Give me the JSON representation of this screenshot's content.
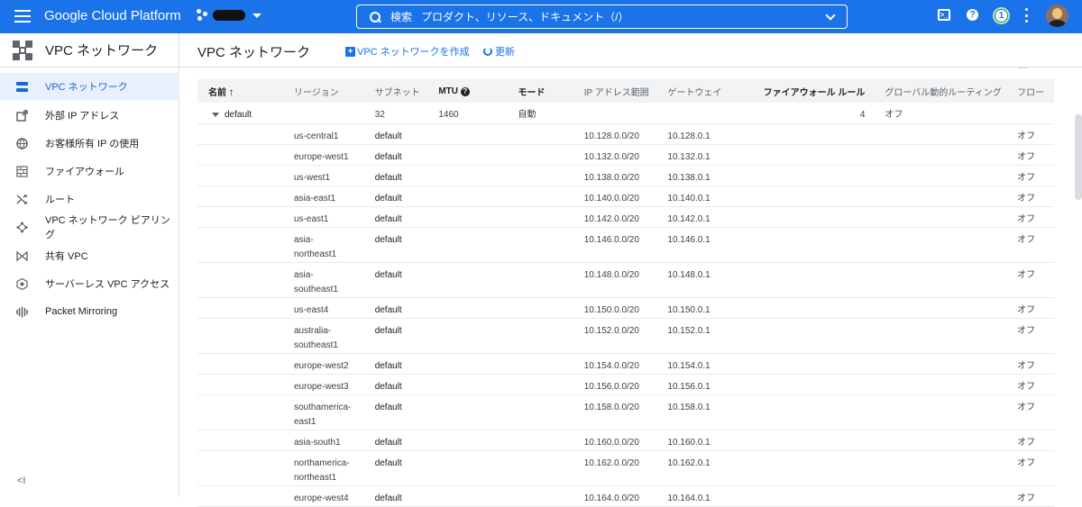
{
  "topbar": {
    "brand": "Google Cloud Platform",
    "search_label": "検索",
    "search_placeholder": "プロダクト、リソース、ドキュメント（/）",
    "notification_count": "1",
    "terminal_glyph": ">_",
    "help_glyph": "?"
  },
  "sidebar": {
    "title": "VPC ネットワーク",
    "items": [
      {
        "label": "VPC ネットワーク",
        "icon": "vpc-network-icon"
      },
      {
        "label": "外部 IP アドレス",
        "icon": "external-ip-icon"
      },
      {
        "label": "お客様所有 IP の使用",
        "icon": "globe-icon"
      },
      {
        "label": "ファイアウォール",
        "icon": "firewall-icon"
      },
      {
        "label": "ルート",
        "icon": "routes-icon"
      },
      {
        "label": "VPC ネットワーク ピアリング",
        "icon": "peering-icon"
      },
      {
        "label": "共有 VPC",
        "icon": "shared-vpc-icon"
      },
      {
        "label": "サーバーレス VPC アクセス",
        "icon": "serverless-icon"
      },
      {
        "label": "Packet Mirroring",
        "icon": "packet-mirroring-icon"
      }
    ],
    "collapse_label": "<I"
  },
  "main": {
    "title": "VPC ネットワーク",
    "create_label": "VPC ネットワークを作成",
    "refresh_label": "更新"
  },
  "table": {
    "headers": {
      "name": "名前",
      "region": "リージョン",
      "subnet": "サブネット",
      "mtu": "MTU",
      "mode": "モード",
      "ip_range": "IP アドレス範囲",
      "gateway": "ゲートウェイ",
      "firewall": "ファイアウォール ルール",
      "routing": "グローバル動的ルーティング",
      "flow": "フロー"
    },
    "network": {
      "name": "default",
      "subnets": "32",
      "mtu": "1460",
      "mode": "自動",
      "firewall_rules": "4",
      "routing": "オフ"
    },
    "rows": [
      {
        "region": "us-central1",
        "subnet": "default",
        "ip": "10.128.0.0/20",
        "gateway": "10.128.0.1",
        "flow": "オフ"
      },
      {
        "region": "europe-west1",
        "subnet": "default",
        "ip": "10.132.0.0/20",
        "gateway": "10.132.0.1",
        "flow": "オフ"
      },
      {
        "region": "us-west1",
        "subnet": "default",
        "ip": "10.138.0.0/20",
        "gateway": "10.138.0.1",
        "flow": "オフ"
      },
      {
        "region": "asia-east1",
        "subnet": "default",
        "ip": "10.140.0.0/20",
        "gateway": "10.140.0.1",
        "flow": "オフ"
      },
      {
        "region": "us-east1",
        "subnet": "default",
        "ip": "10.142.0.0/20",
        "gateway": "10.142.0.1",
        "flow": "オフ"
      },
      {
        "region": "asia-northeast1",
        "subnet": "default",
        "ip": "10.146.0.0/20",
        "gateway": "10.146.0.1",
        "flow": "オフ"
      },
      {
        "region": "asia-southeast1",
        "subnet": "default",
        "ip": "10.148.0.0/20",
        "gateway": "10.148.0.1",
        "flow": "オフ"
      },
      {
        "region": "us-east4",
        "subnet": "default",
        "ip": "10.150.0.0/20",
        "gateway": "10.150.0.1",
        "flow": "オフ"
      },
      {
        "region": "australia-southeast1",
        "subnet": "default",
        "ip": "10.152.0.0/20",
        "gateway": "10.152.0.1",
        "flow": "オフ"
      },
      {
        "region": "europe-west2",
        "subnet": "default",
        "ip": "10.154.0.0/20",
        "gateway": "10.154.0.1",
        "flow": "オフ"
      },
      {
        "region": "europe-west3",
        "subnet": "default",
        "ip": "10.156.0.0/20",
        "gateway": "10.156.0.1",
        "flow": "オフ"
      },
      {
        "region": "southamerica-east1",
        "subnet": "default",
        "ip": "10.158.0.0/20",
        "gateway": "10.158.0.1",
        "flow": "オフ"
      },
      {
        "region": "asia-south1",
        "subnet": "default",
        "ip": "10.160.0.0/20",
        "gateway": "10.160.0.1",
        "flow": "オフ"
      },
      {
        "region": "northamerica-northeast1",
        "subnet": "default",
        "ip": "10.162.0.0/20",
        "gateway": "10.162.0.1",
        "flow": "オフ"
      },
      {
        "region": "europe-west4",
        "subnet": "default",
        "ip": "10.164.0.0/20",
        "gateway": "10.164.0.1",
        "flow": "オフ"
      }
    ]
  },
  "colors": {
    "topbar": "#1a73e8",
    "active_nav": "#e8f0fe",
    "link": "#1a73e8",
    "notification": "#1e8e3e"
  }
}
